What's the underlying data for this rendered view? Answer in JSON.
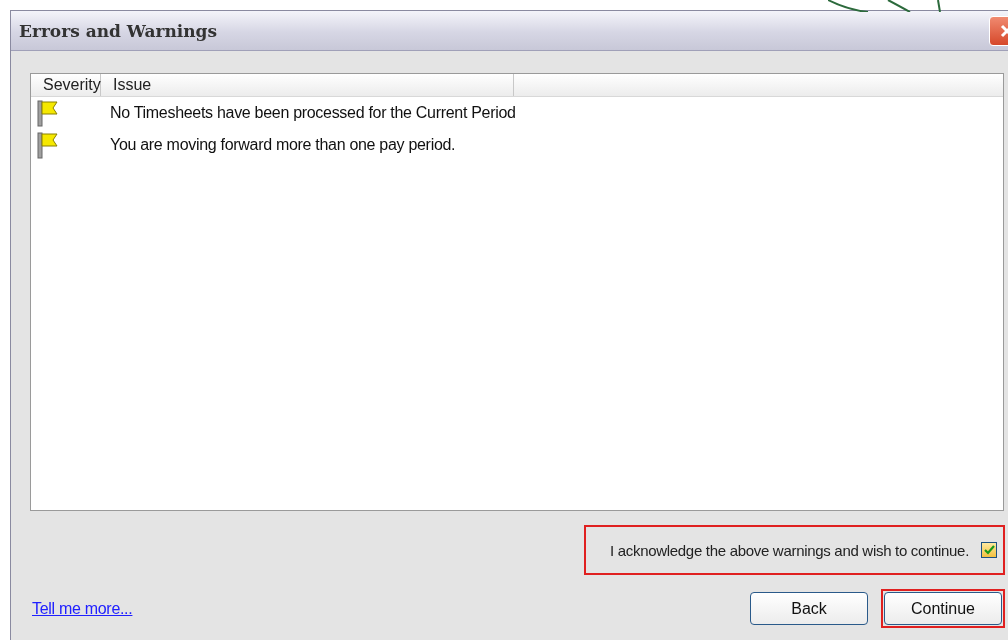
{
  "window": {
    "title": "Errors and Warnings"
  },
  "table": {
    "columns": [
      "Severity",
      "Issue"
    ],
    "rows": [
      {
        "kind": "warning",
        "issue": "No Timesheets have been processed for the Current Period"
      },
      {
        "kind": "warning",
        "issue": "You are moving forward more than one pay period."
      }
    ]
  },
  "acknowledge": {
    "label": "I acknowledge the above warnings and wish to continue.",
    "checked": true,
    "highlighted": true
  },
  "link": "Tell me more...",
  "buttons": [
    {
      "label": "Back",
      "highlighted": false
    },
    {
      "label": "Continue",
      "highlighted": true
    }
  ]
}
